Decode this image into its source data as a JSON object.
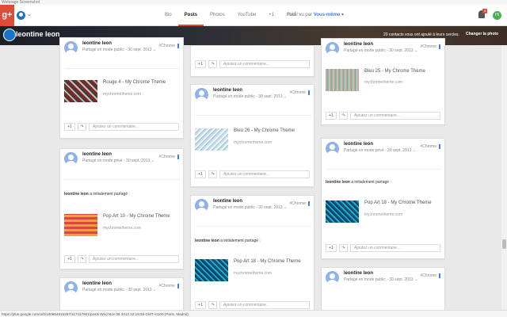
{
  "window": {
    "caption": "Webpage Screenshot"
  },
  "topbar": {
    "logo": "g+",
    "tabs": [
      "Bio",
      "Posts",
      "Photos",
      "YouTube",
      "+1",
      "Avis"
    ],
    "active_tab": "Posts",
    "profile_view_label": "Profil vu par",
    "profile_view_value": "Vous-même",
    "notif_count": "3",
    "share_icon_text": "Hi"
  },
  "cover": {
    "name": "leontine leon",
    "message": "20 contacts vous ont ajouté à leurs cercles.",
    "change_photo": "Changer la photo"
  },
  "common": {
    "author": "leontine leon",
    "public": "Partagé en mode public",
    "private": "Partagé en mode privé",
    "date": "30 sept. 2013",
    "tag": "#Chrome",
    "plus1": "+1",
    "share": "↷",
    "comment_placeholder": "Ajoutez un commentaire...",
    "reshare_suffix": " a initialement partagé :",
    "url": "mychrometheme.com"
  },
  "posts": [
    {
      "title": "Rouge 4 - My Chrome Theme"
    },
    {
      "title": "Pop Art 10 - My Chrome Theme"
    },
    {
      "title": "Bleu 26 - My Chrome Theme"
    },
    {
      "title": "Pop Art 18 - My Chrome Theme"
    },
    {
      "title": "Bleu 25 - My Chrome Theme"
    },
    {
      "title": "Pop Art 18 - My Chrome Theme"
    }
  ],
  "statusbar": "https://plus.google.com/u/0/100654816297/117417601/posts Wed Nov 06 2013 22:15:56 GMT+0100 (Paris, Madrid)"
}
